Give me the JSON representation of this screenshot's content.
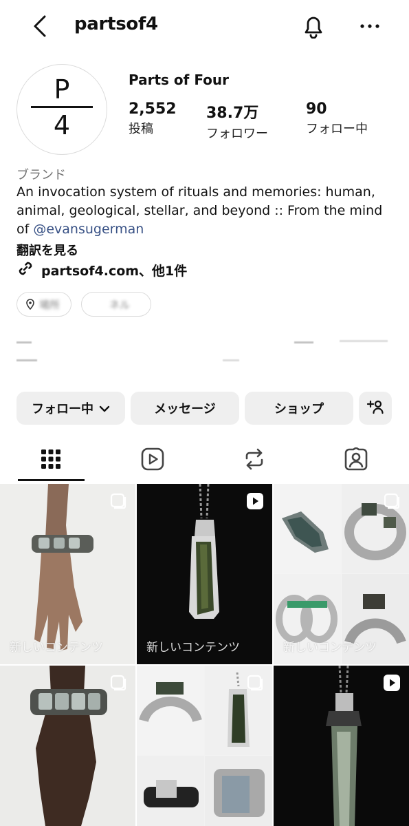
{
  "header": {
    "username": "partsof4"
  },
  "profile": {
    "avatar_top": "P",
    "avatar_bottom": "4",
    "display_name": "Parts of Four",
    "stats": [
      {
        "value": "2,552",
        "label": "投稿"
      },
      {
        "value": "38.7万",
        "label": "フォロワー"
      },
      {
        "value": "90",
        "label": "フォロー中"
      }
    ],
    "category": "ブランド",
    "bio_text": "An invocation system of rituals and memories: human, animal, geological, stellar, and beyond :: From the mind of ",
    "bio_mention": "@evansugerman",
    "translate": "翻訳を見る",
    "link": "partsof4.com、他1件"
  },
  "pills": [
    {
      "label": "場所"
    },
    {
      "label": "ネル"
    }
  ],
  "actions": {
    "following": "フォロー中",
    "message": "メッセージ",
    "shop": "ショップ"
  },
  "tabs": [
    {
      "name": "grid"
    },
    {
      "name": "reels"
    },
    {
      "name": "reposts"
    },
    {
      "name": "tagged"
    }
  ],
  "grid": [
    {
      "label": "新しいコンテンツ",
      "type": "carousel"
    },
    {
      "label": "新しいコンテンツ",
      "type": "reel"
    },
    {
      "label": "新しいコンテンツ",
      "type": "carousel"
    },
    {
      "label": "",
      "type": "carousel"
    },
    {
      "label": "",
      "type": "carousel"
    },
    {
      "label": "",
      "type": "reel"
    }
  ],
  "colors": {
    "link": "#385185",
    "button_bg": "#efefef",
    "muted": "#737373"
  }
}
